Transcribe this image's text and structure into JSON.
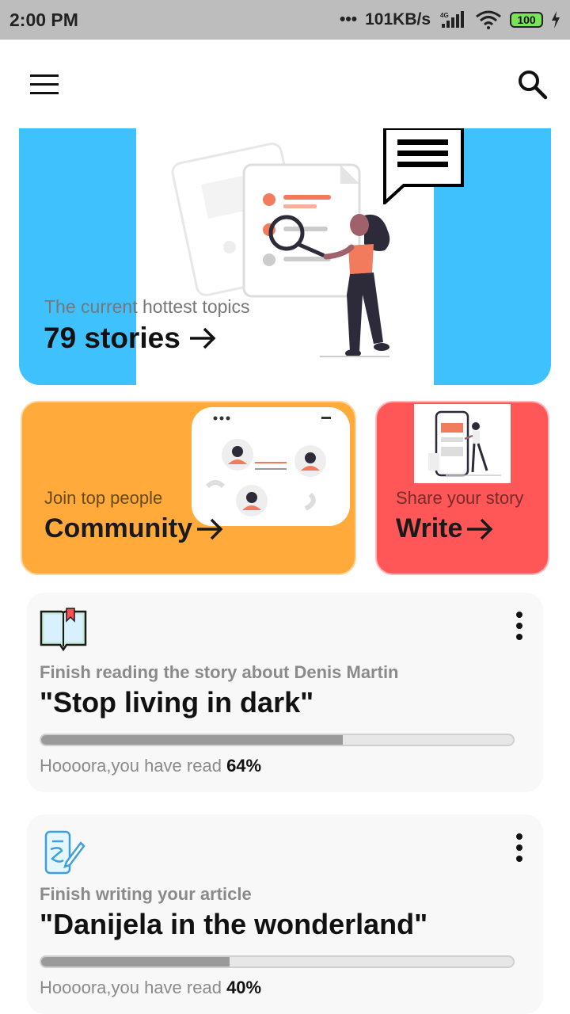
{
  "status_bar": {
    "time": "2:00 PM",
    "speed": "101KB/s",
    "network": "4G",
    "battery": "100"
  },
  "hero": {
    "subtitle": "The current hottest topics",
    "title": "79 stories"
  },
  "community": {
    "subtitle": "Join top people",
    "title": "Community"
  },
  "write": {
    "subtitle": "Share your story",
    "title": "Write"
  },
  "cards": [
    {
      "icon": "book-icon",
      "subtitle": "Finish reading the story about Denis Martin",
      "title": "\"Stop living in dark\"",
      "status_prefix": "Hoooora,you have read ",
      "percent_label": "64%",
      "progress": 0.64
    },
    {
      "icon": "write-icon",
      "subtitle": "Finish writing your article",
      "title": "\"Danijela in the wonderland\"",
      "status_prefix": "Hoooora,you have read ",
      "percent_label": "40%",
      "progress": 0.4
    }
  ],
  "colors": {
    "hero_blue": "#3fc1fd",
    "community_orange": "#ffaa3b",
    "write_red": "#ff5757",
    "accent_person": "#f27a5d"
  }
}
